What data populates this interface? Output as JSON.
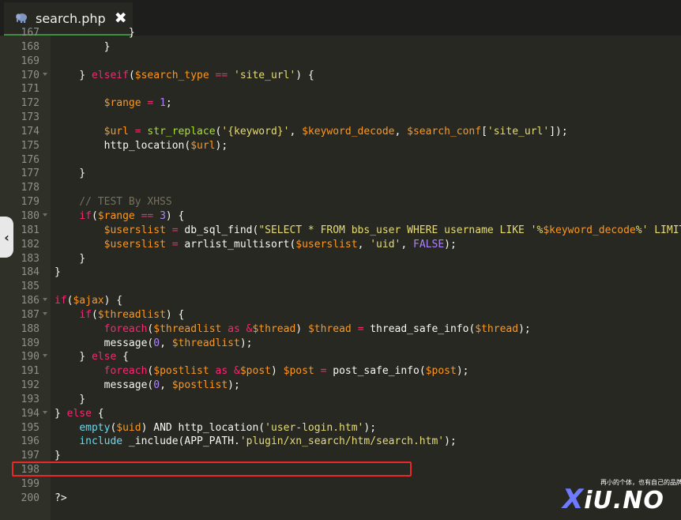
{
  "tab": {
    "title": "search.php",
    "close_icon": "✖",
    "file_icon": "elephant-icon"
  },
  "editor": {
    "colors": {
      "background": "#272822",
      "gutter": "#2f3129",
      "highlight_box": "#e8292a"
    },
    "lines": [
      {
        "n": "167",
        "fold": false,
        "code": [
          [
            "t-p",
            "            }"
          ]
        ]
      },
      {
        "n": "168",
        "fold": false,
        "code": [
          [
            "t-p",
            "        }"
          ]
        ]
      },
      {
        "n": "169",
        "fold": false,
        "code": []
      },
      {
        "n": "170",
        "fold": true,
        "code": [
          [
            "t-p",
            "    } "
          ],
          [
            "t-k",
            "elseif"
          ],
          [
            "t-p",
            "("
          ],
          [
            "t-v",
            "$search_type"
          ],
          [
            "t-p",
            " "
          ],
          [
            "t-k",
            "=="
          ],
          [
            "t-p",
            " "
          ],
          [
            "t-s",
            "'site_url'"
          ],
          [
            "t-p",
            ") {"
          ]
        ]
      },
      {
        "n": "171",
        "fold": false,
        "code": []
      },
      {
        "n": "172",
        "fold": false,
        "code": [
          [
            "t-p",
            "        "
          ],
          [
            "t-v",
            "$range"
          ],
          [
            "t-p",
            " "
          ],
          [
            "t-k",
            "="
          ],
          [
            "t-p",
            " "
          ],
          [
            "t-n",
            "1"
          ],
          [
            "t-p",
            ";"
          ]
        ]
      },
      {
        "n": "173",
        "fold": false,
        "code": []
      },
      {
        "n": "174",
        "fold": false,
        "code": [
          [
            "t-p",
            "        "
          ],
          [
            "t-v",
            "$url"
          ],
          [
            "t-p",
            " "
          ],
          [
            "t-k",
            "="
          ],
          [
            "t-p",
            " "
          ],
          [
            "t-f",
            "str_replace"
          ],
          [
            "t-p",
            "("
          ],
          [
            "t-s",
            "'{keyword}'"
          ],
          [
            "t-p",
            ", "
          ],
          [
            "t-v",
            "$keyword_decode"
          ],
          [
            "t-p",
            ", "
          ],
          [
            "t-v",
            "$search_conf"
          ],
          [
            "t-p",
            "["
          ],
          [
            "t-s",
            "'site_url'"
          ],
          [
            "t-p",
            "]);"
          ]
        ]
      },
      {
        "n": "175",
        "fold": false,
        "code": [
          [
            "t-p",
            "        http_location("
          ],
          [
            "t-v",
            "$url"
          ],
          [
            "t-p",
            ");"
          ]
        ]
      },
      {
        "n": "176",
        "fold": false,
        "code": []
      },
      {
        "n": "177",
        "fold": false,
        "code": [
          [
            "t-p",
            "    }"
          ]
        ]
      },
      {
        "n": "178",
        "fold": false,
        "code": []
      },
      {
        "n": "179",
        "fold": false,
        "code": [
          [
            "t-c",
            "    // TEST By XHSS"
          ]
        ]
      },
      {
        "n": "180",
        "fold": true,
        "code": [
          [
            "t-p",
            "    "
          ],
          [
            "t-k",
            "if"
          ],
          [
            "t-p",
            "("
          ],
          [
            "t-v",
            "$range"
          ],
          [
            "t-p",
            " "
          ],
          [
            "t-k",
            "=="
          ],
          [
            "t-p",
            " "
          ],
          [
            "t-n",
            "3"
          ],
          [
            "t-p",
            ") {"
          ]
        ]
      },
      {
        "n": "181",
        "fold": false,
        "code": [
          [
            "t-p",
            "        "
          ],
          [
            "t-v",
            "$userslist"
          ],
          [
            "t-p",
            " "
          ],
          [
            "t-k",
            "="
          ],
          [
            "t-p",
            " db_sql_find("
          ],
          [
            "t-s",
            "\"SELECT * FROM bbs_user WHERE username LIKE '%"
          ],
          [
            "t-v",
            "$keyword_decode"
          ],
          [
            "t-s",
            "%' LIMIT"
          ]
        ]
      },
      {
        "n": "182",
        "fold": false,
        "code": [
          [
            "t-p",
            "        "
          ],
          [
            "t-v",
            "$userslist"
          ],
          [
            "t-p",
            " "
          ],
          [
            "t-k",
            "="
          ],
          [
            "t-p",
            " arrlist_multisort("
          ],
          [
            "t-v",
            "$userslist"
          ],
          [
            "t-p",
            ", "
          ],
          [
            "t-s",
            "'uid'"
          ],
          [
            "t-p",
            ", "
          ],
          [
            "t-n",
            "FALSE"
          ],
          [
            "t-p",
            ");"
          ]
        ]
      },
      {
        "n": "183",
        "fold": false,
        "code": [
          [
            "t-p",
            "    }"
          ]
        ]
      },
      {
        "n": "184",
        "fold": false,
        "code": [
          [
            "t-p",
            "}"
          ]
        ]
      },
      {
        "n": "185",
        "fold": false,
        "code": []
      },
      {
        "n": "186",
        "fold": true,
        "code": [
          [
            "t-k",
            "if"
          ],
          [
            "t-p",
            "("
          ],
          [
            "t-v",
            "$ajax"
          ],
          [
            "t-p",
            ") {"
          ]
        ]
      },
      {
        "n": "187",
        "fold": true,
        "code": [
          [
            "t-p",
            "    "
          ],
          [
            "t-k",
            "if"
          ],
          [
            "t-p",
            "("
          ],
          [
            "t-v",
            "$threadlist"
          ],
          [
            "t-p",
            ") {"
          ]
        ]
      },
      {
        "n": "188",
        "fold": false,
        "code": [
          [
            "t-p",
            "        "
          ],
          [
            "t-k",
            "foreach"
          ],
          [
            "t-p",
            "("
          ],
          [
            "t-v",
            "$threadlist"
          ],
          [
            "t-p",
            " "
          ],
          [
            "t-k",
            "as"
          ],
          [
            "t-p",
            " "
          ],
          [
            "t-k",
            "&"
          ],
          [
            "t-v",
            "$thread"
          ],
          [
            "t-p",
            ") "
          ],
          [
            "t-v",
            "$thread"
          ],
          [
            "t-p",
            " "
          ],
          [
            "t-k",
            "="
          ],
          [
            "t-p",
            " thread_safe_info("
          ],
          [
            "t-v",
            "$thread"
          ],
          [
            "t-p",
            ");"
          ]
        ]
      },
      {
        "n": "189",
        "fold": false,
        "code": [
          [
            "t-p",
            "        message("
          ],
          [
            "t-n",
            "0"
          ],
          [
            "t-p",
            ", "
          ],
          [
            "t-v",
            "$threadlist"
          ],
          [
            "t-p",
            ");"
          ]
        ]
      },
      {
        "n": "190",
        "fold": true,
        "code": [
          [
            "t-p",
            "    } "
          ],
          [
            "t-k",
            "else"
          ],
          [
            "t-p",
            " {"
          ]
        ]
      },
      {
        "n": "191",
        "fold": false,
        "code": [
          [
            "t-p",
            "        "
          ],
          [
            "t-k",
            "foreach"
          ],
          [
            "t-p",
            "("
          ],
          [
            "t-v",
            "$postlist"
          ],
          [
            "t-p",
            " "
          ],
          [
            "t-k",
            "as"
          ],
          [
            "t-p",
            " "
          ],
          [
            "t-k",
            "&"
          ],
          [
            "t-v",
            "$post"
          ],
          [
            "t-p",
            ") "
          ],
          [
            "t-v",
            "$post"
          ],
          [
            "t-p",
            " "
          ],
          [
            "t-k",
            "="
          ],
          [
            "t-p",
            " post_safe_info("
          ],
          [
            "t-v",
            "$post"
          ],
          [
            "t-p",
            ");"
          ]
        ]
      },
      {
        "n": "192",
        "fold": false,
        "code": [
          [
            "t-p",
            "        message("
          ],
          [
            "t-n",
            "0"
          ],
          [
            "t-p",
            ", "
          ],
          [
            "t-v",
            "$postlist"
          ],
          [
            "t-p",
            ");"
          ]
        ]
      },
      {
        "n": "193",
        "fold": false,
        "code": [
          [
            "t-p",
            "    }"
          ]
        ]
      },
      {
        "n": "194",
        "fold": true,
        "code": [
          [
            "t-p",
            "} "
          ],
          [
            "t-k",
            "else"
          ],
          [
            "t-p",
            " {"
          ]
        ]
      },
      {
        "n": "195",
        "fold": false,
        "code": [
          [
            "t-p",
            "    "
          ],
          [
            "t-b",
            "empty"
          ],
          [
            "t-p",
            "("
          ],
          [
            "t-v",
            "$uid"
          ],
          [
            "t-p",
            ") AND http_location("
          ],
          [
            "t-s",
            "'user-login.htm'"
          ],
          [
            "t-p",
            ");"
          ]
        ]
      },
      {
        "n": "196",
        "fold": false,
        "code": [
          [
            "t-p",
            "    "
          ],
          [
            "t-b",
            "include"
          ],
          [
            "t-p",
            " _include(APP_PATH."
          ],
          [
            "t-s",
            "'plugin/xn_search/htm/search.htm'"
          ],
          [
            "t-p",
            ");"
          ]
        ]
      },
      {
        "n": "197",
        "fold": false,
        "code": [
          [
            "t-p",
            "}"
          ]
        ]
      },
      {
        "n": "198",
        "fold": false,
        "code": []
      },
      {
        "n": "199",
        "fold": false,
        "code": []
      },
      {
        "n": "200",
        "fold": false,
        "code": [
          [
            "t-p",
            "?>"
          ]
        ]
      }
    ]
  },
  "side_handle": {
    "glyph": "‹"
  },
  "watermark": {
    "logo_x": "X",
    "logo_text": "iU.NO",
    "slogan": "再小的个体，也有自己的品牌"
  }
}
